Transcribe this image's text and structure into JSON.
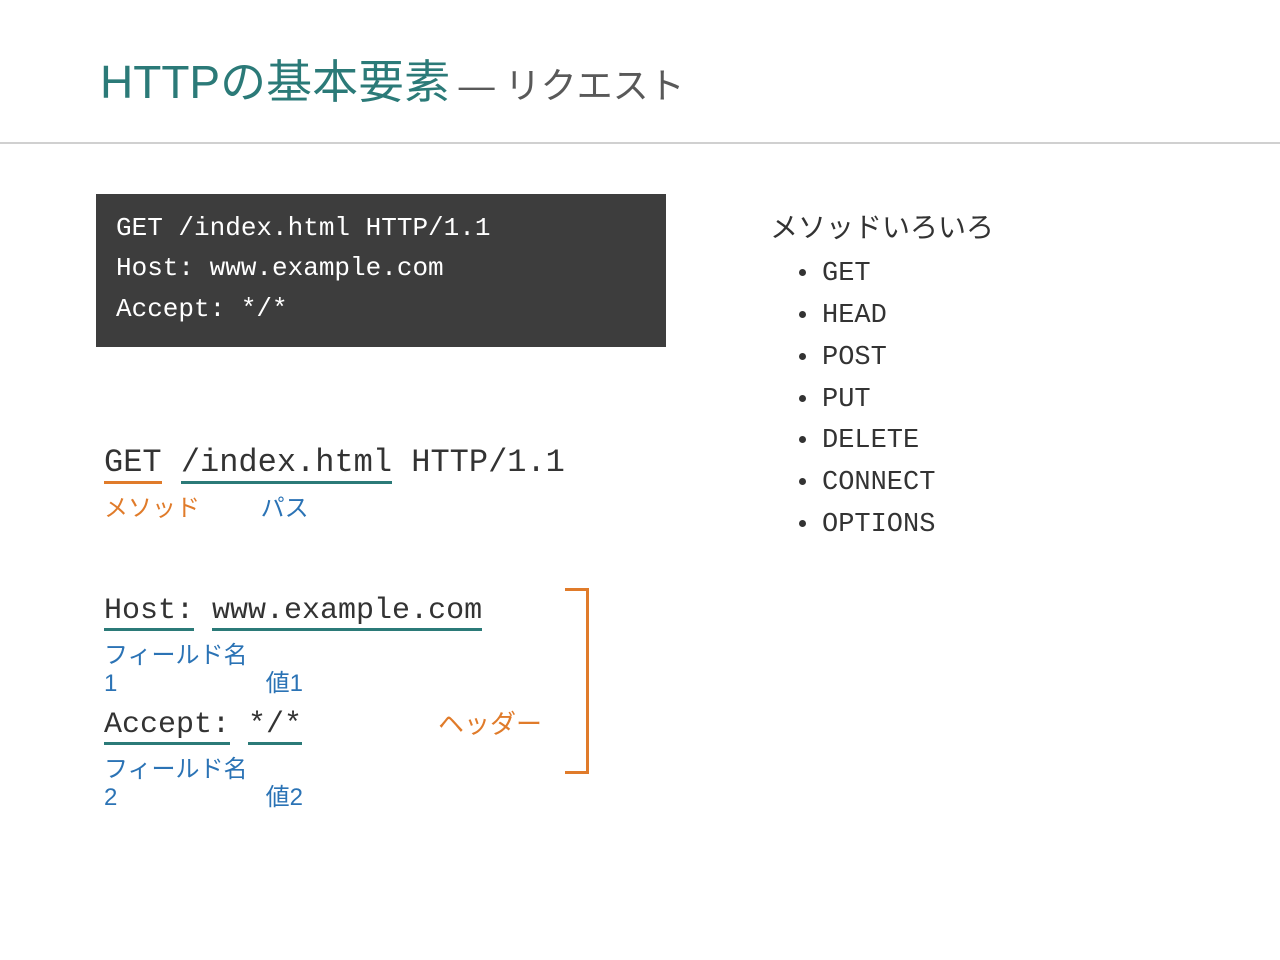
{
  "title": {
    "main": "HTTPの基本要素",
    "sub": "— リクエスト"
  },
  "codebox": {
    "line1": "GET /index.html HTTP/1.1",
    "line2": "Host: www.example.com",
    "line3": "Accept: */*"
  },
  "breakdown1": {
    "method": "GET",
    "path": "/index.html",
    "version": "HTTP/1.1",
    "method_label": "メソッド",
    "path_label": "パス"
  },
  "breakdown2": {
    "field1": "Host:",
    "value1": "www.example.com",
    "field1_label": "フィールド名1",
    "value1_label": "値1",
    "field2": "Accept:",
    "value2": "*/*",
    "field2_label": "フィールド名2",
    "value2_label": "値2",
    "bracket_label": "ヘッダー"
  },
  "methods": {
    "title": "メソッドいろいろ",
    "items": [
      "GET",
      "HEAD",
      "POST",
      "PUT",
      "DELETE",
      "CONNECT",
      "OPTIONS"
    ]
  }
}
